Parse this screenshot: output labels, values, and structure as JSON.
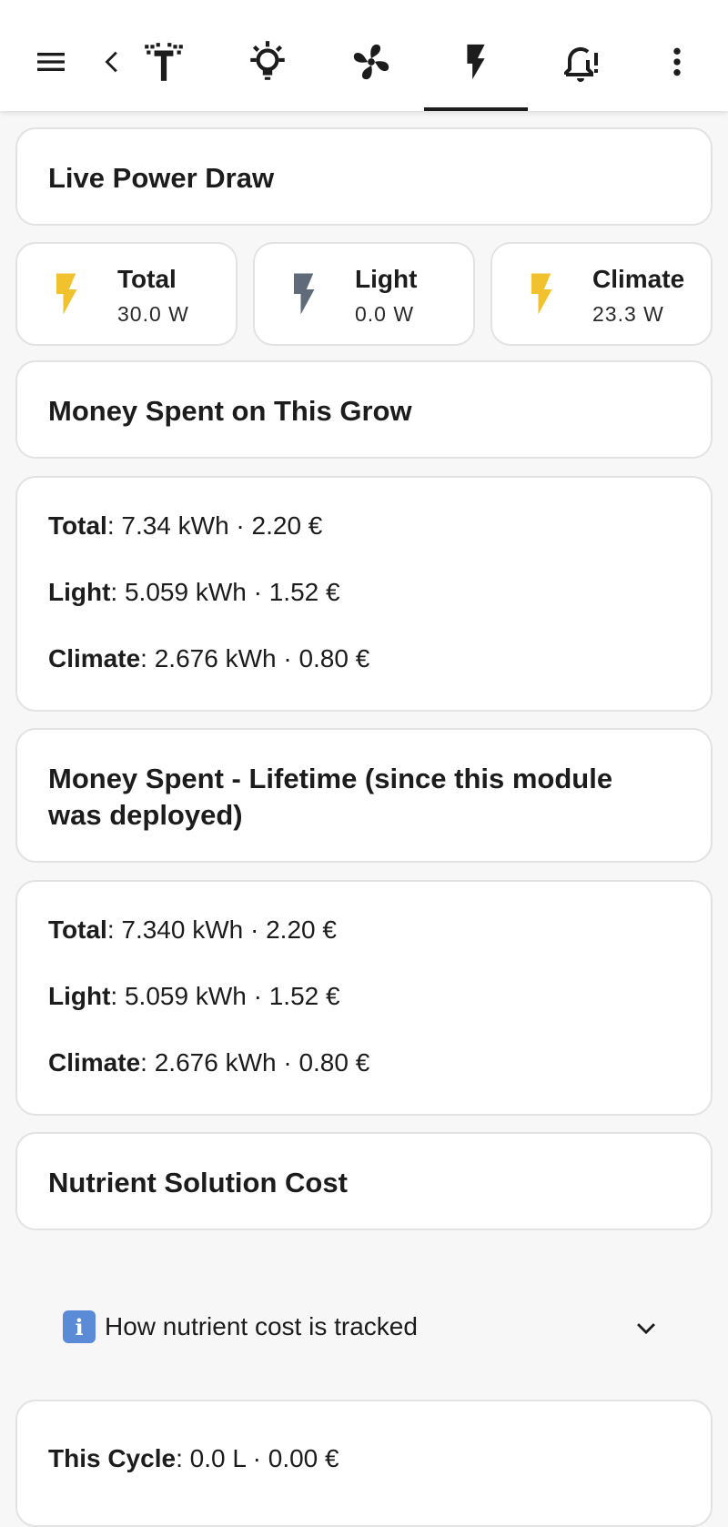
{
  "topbar": {
    "icons": [
      "menu-icon",
      "back-icon",
      "sprinkler-icon",
      "lightbulb-icon",
      "fan-icon",
      "lightning-icon",
      "bell-alert-icon",
      "more-vert-icon"
    ],
    "active_tab": "lightning-icon"
  },
  "live_power": {
    "title": "Live Power Draw",
    "chips": [
      {
        "label": "Total",
        "value": "30.0 W",
        "color": "#f2c12e"
      },
      {
        "label": "Light",
        "value": "0.0 W",
        "color": "#5f6b78"
      },
      {
        "label": "Climate",
        "value": "23.3 W",
        "color": "#f2c12e"
      }
    ]
  },
  "grow_cost": {
    "title": "Money Spent on This Grow",
    "rows": [
      {
        "label": "Total",
        "value": ": 7.34 kWh · 2.20 €"
      },
      {
        "label": "Light",
        "value": ": 5.059 kWh · 1.52 €"
      },
      {
        "label": "Climate",
        "value": ": 2.676 kWh · 0.80 €"
      }
    ]
  },
  "lifetime_cost": {
    "title_line1": "Money Spent - Lifetime (since this module",
    "title_line2": "was deployed)",
    "rows": [
      {
        "label": "Total",
        "value": ": 7.340 kWh · 2.20 €"
      },
      {
        "label": "Light",
        "value": ": 5.059 kWh · 1.52 €"
      },
      {
        "label": "Climate",
        "value": ": 2.676 kWh · 0.80 €"
      }
    ]
  },
  "nutrient": {
    "title": "Nutrient Solution Cost",
    "expander_icon": "i",
    "expander_label": "How nutrient cost is tracked",
    "cycle_label": "This Cycle",
    "cycle_value": ": 0.0 L · 0.00 €"
  },
  "colors": {
    "accent": "#1c1c1c",
    "bolt_yellow": "#f2c12e",
    "bolt_grey": "#5f6b78",
    "info_blue": "#5b8bd6"
  }
}
